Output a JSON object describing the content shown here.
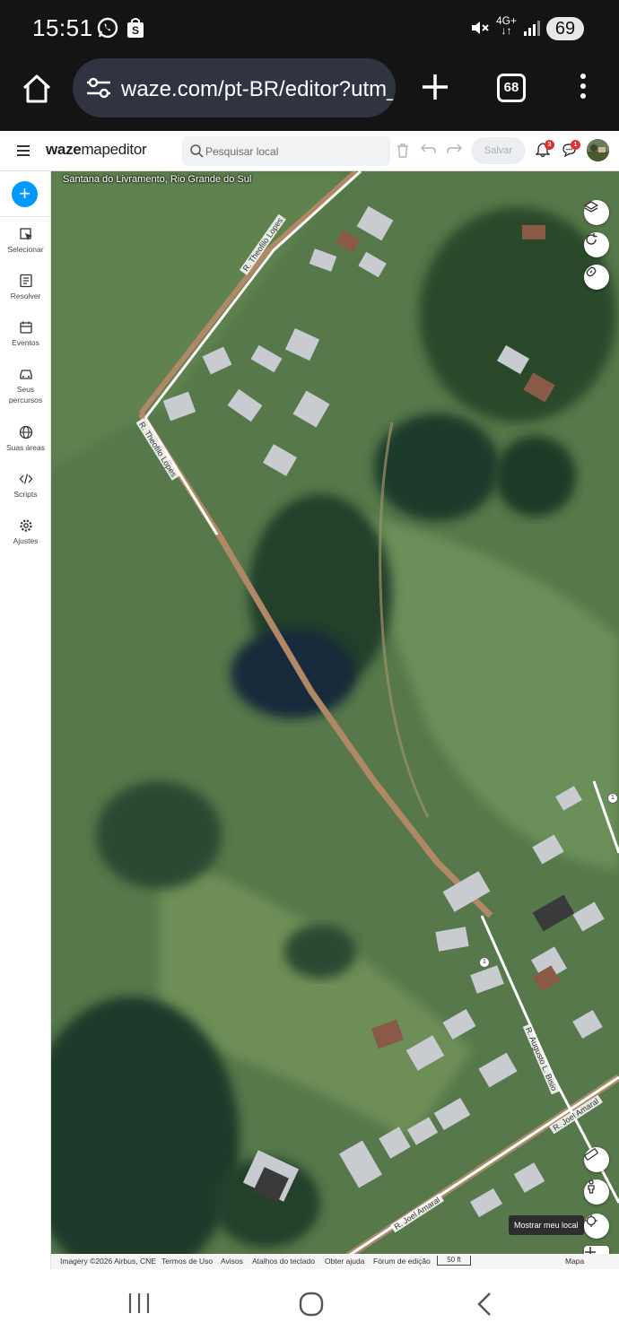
{
  "status_bar": {
    "time": "15:51",
    "network": "4G+",
    "battery": "69",
    "icons": [
      "whatsapp-icon",
      "shopping-bag-icon",
      "mute-icon",
      "signal-icon"
    ]
  },
  "browser": {
    "url": "waze.com/pt-BR/editor?utm_s",
    "tab_count": "68"
  },
  "editor": {
    "logo_bold": "waze",
    "logo_rest": "mapeditor",
    "search_placeholder": "Pesquisar local",
    "save_label": "Salvar",
    "notifications_count": "3",
    "messages_count": "1"
  },
  "sidebar": {
    "items": [
      {
        "label": "Selecionar",
        "icon": "select-icon"
      },
      {
        "label": "Resolver",
        "icon": "resolve-icon"
      },
      {
        "label": "Eventos",
        "icon": "calendar-icon"
      },
      {
        "label": "Seus percursos",
        "icon": "car-icon"
      },
      {
        "label": "Suas áreas",
        "icon": "globe-icon"
      },
      {
        "label": "Scripts",
        "icon": "code-icon"
      },
      {
        "label": "Ajustes",
        "icon": "settings-icon"
      }
    ]
  },
  "map": {
    "location": "Santana do Livramento, Rio Grande do Sul",
    "roads": [
      "R. Theofilo Lopes",
      "R. Theofilo Lopes",
      "R. Augusto L. Bisio",
      "R. Joel Amaral",
      "R. Joel Amaral"
    ],
    "segment_markers": [
      "1",
      "1"
    ],
    "show_location_tooltip": "Mostrar meu local"
  },
  "footer": {
    "imagery": "Imagery ©2026 Airbus, CNE",
    "terms": "Termos de Uso",
    "notices": "Avisos",
    "shortcuts": "Atalhos do teclado",
    "help": "Obter ajuda",
    "forum": "Fórum de edição",
    "scale": "50 ft",
    "map_link": "Mapa"
  },
  "colors": {
    "accent": "#0099ff",
    "badge": "#e03131",
    "status_bar": "#141414",
    "url_pill": "#2f3440"
  }
}
